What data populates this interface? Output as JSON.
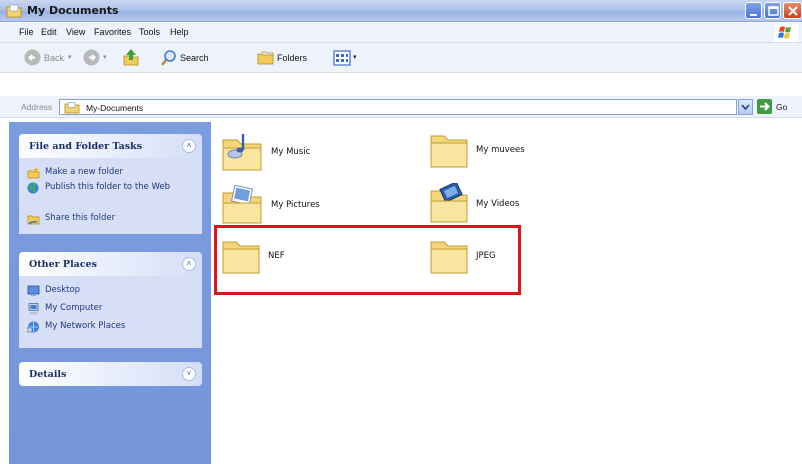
{
  "window": {
    "title": "My Documents"
  },
  "menu": [
    "File",
    "Edit",
    "View",
    "Favorites",
    "Tools",
    "Help"
  ],
  "toolbar": {
    "back_label": "Back",
    "search_label": "Search",
    "folders_label": "Folders"
  },
  "address": {
    "label": "Address",
    "value": "My-Documents",
    "go_label": "Go"
  },
  "taskpane": {
    "file_tasks": {
      "title": "File and Folder Tasks",
      "items": [
        "Make a new folder",
        "Publish this folder to the Web",
        "Share this folder"
      ]
    },
    "other_places": {
      "title": "Other Places",
      "items": [
        "Desktop",
        "My Computer",
        "My Network Places"
      ]
    },
    "details": {
      "title": "Details"
    }
  },
  "folders": [
    "My Music",
    "My muvees",
    "My Pictures",
    "My Videos",
    "NEF",
    "JPEG"
  ],
  "colors": {
    "highlight": "#e0141b",
    "taskpane": "#7596d9",
    "folder": "#f5d76e"
  }
}
